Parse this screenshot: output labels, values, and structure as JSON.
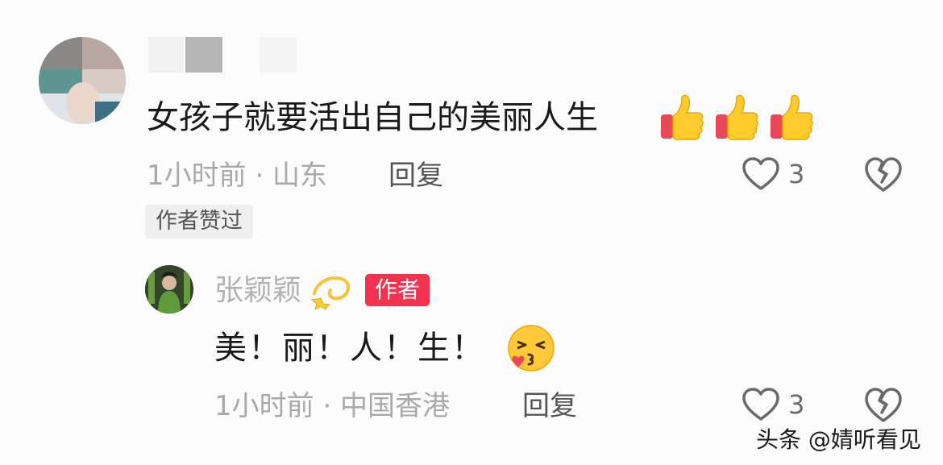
{
  "comment": {
    "text": "女孩子就要活出自己的美丽人生",
    "emoji": "thumbs-up-icon",
    "meta": "1小时前 · 山东",
    "reply_label": "回复",
    "like_count": "3",
    "author_liked_tag": "作者赞过"
  },
  "reply": {
    "username": "张颖颖",
    "author_badge": "作者",
    "text": "美！丽！人！生！",
    "meta": "1小时前 · 中国香港",
    "reply_label": "回复",
    "like_count": "3"
  },
  "watermark": "头条 @婧听看见",
  "colors": {
    "author_badge_bg": "#f2334f",
    "meta_text": "#a9a9a9",
    "tag_bg": "#efefef"
  }
}
